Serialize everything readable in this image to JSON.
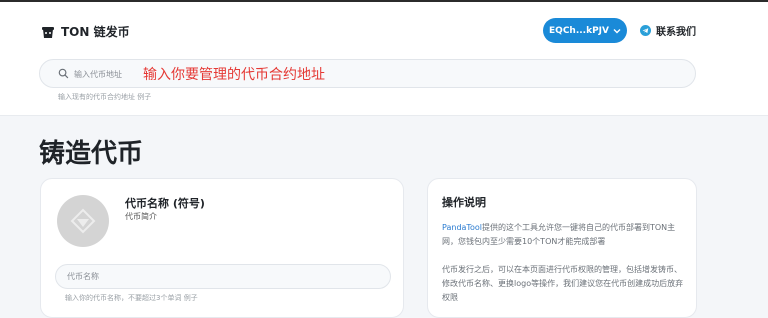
{
  "header": {
    "brand": "TON 链发币",
    "logo_icon": "bucket-logo-icon",
    "wallet_button": "EQCh...kPJV",
    "contact_label": "联系我们",
    "contact_icon": "telegram-icon"
  },
  "search": {
    "placeholder": "输入代币地址",
    "annotation": "输入你要管理的代币合约地址",
    "hint_text": "输入现有的代币合约地址",
    "hint_link": "例子"
  },
  "page": {
    "title": "铸造代币"
  },
  "token_form": {
    "name_heading": "代币名称 (符号)",
    "description": "代币简介",
    "name_placeholder": "代币名称",
    "name_hint": "输入你的代币名称，不要超过3个单词",
    "name_hint_link": "例子"
  },
  "instructions": {
    "title": "操作说明",
    "p1_link": "PandaTool",
    "p1_text": "提供的这个工具允许您一键将自己的代币部署到TON主网，您钱包内至少需要10个TON才能完成部署",
    "p2_text": "代币发行之后，可以在本页面进行代币权限的管理，包括增发铸币、修改代币名称、更换logo等操作，我们建议您在代币创建成功后放弃权限"
  },
  "colors": {
    "accent": "#1a8ad8",
    "annotation": "#e53935",
    "link": "#2a7bd0"
  }
}
